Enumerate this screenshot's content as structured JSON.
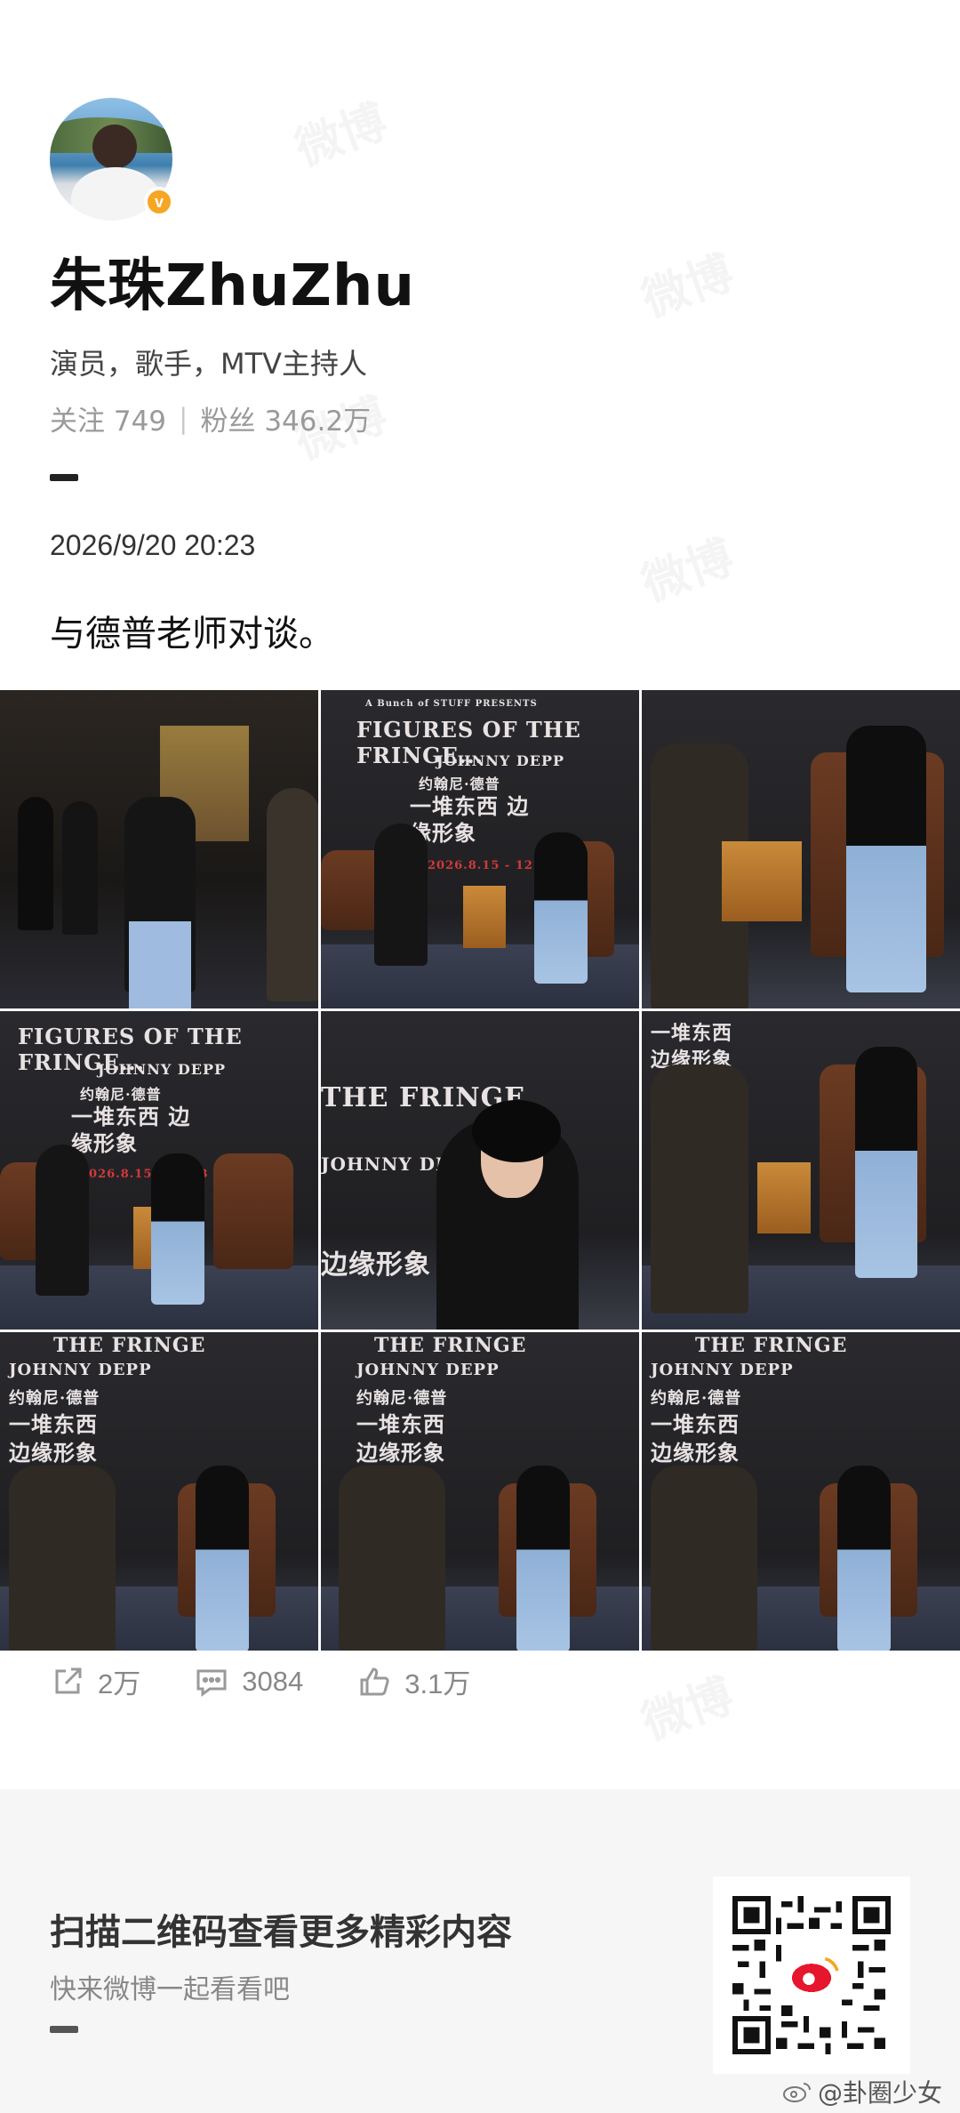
{
  "profile": {
    "name": "朱珠ZhuZhu",
    "bio": "演员，歌手，MTV主持人",
    "following_label": "关注 749",
    "followers_label": "粉丝 346.2万",
    "verified_badge": "v"
  },
  "post": {
    "timestamp": "2026/9/20 20:23",
    "text": "与德普老师对谈。"
  },
  "photos": {
    "poster_title": "FIGURES OF THE FRINGE...",
    "poster_name": "JOHNNY DEPP",
    "poster_cn_name": "约翰尼·德普",
    "poster_cn_title": "一堆东西 边缘形象",
    "poster_dates": "2026.8.15 - 12.13",
    "poster_top": "A Bunch of STUFF PRESENTS"
  },
  "actions": {
    "share_count": "2万",
    "comment_count": "3084",
    "like_count": "3.1万"
  },
  "footer": {
    "title": "扫描二维码查看更多精彩内容",
    "subtitle": "快来微博一起看看吧",
    "credit": "@卦圈少女"
  },
  "watermark": "微博",
  "colors": {
    "badge": "#f5a623",
    "accent_text": "#111111",
    "muted_text": "#9a9a9a"
  }
}
